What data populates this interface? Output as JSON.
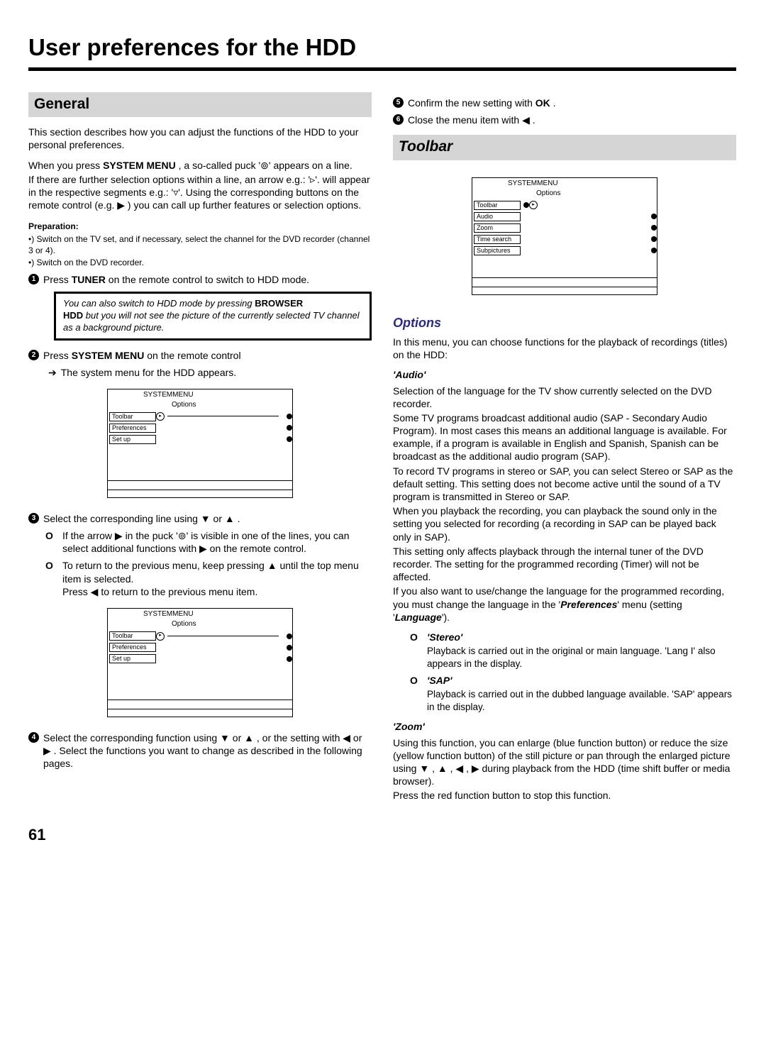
{
  "page": {
    "title": "User preferences for the HDD",
    "number": "61"
  },
  "left": {
    "section_heading": "General",
    "intro1": "This section describes how you can adjust the functions of the HDD to your personal preferences.",
    "intro2_pre": "When you press ",
    "intro2_btn": "SYSTEM MENU",
    "intro2_post": " , a so-called puck '⊚' appears on a line.",
    "intro3": "If there are further selection options within a line, an arrow e.g.: '▹'. will appear in the respective segments e.g.: '▿'. Using the corresponding buttons on the remote control (e.g. ▶ ) you can call up further features or selection options.",
    "prep_label": "Preparation:",
    "prep1": "•) Switch on the TV set, and if necessary, select the channel for the DVD recorder (channel 3 or 4).",
    "prep2": "•) Switch on the DVD recorder.",
    "step1_pre": "Press ",
    "step1_btn": "TUNER",
    "step1_post": " on the remote control to switch to HDD mode.",
    "callout_line1_pre": "You can also switch to HDD mode by pressing ",
    "callout_line1_b1": "BROWSER",
    "callout_line2_b": "HDD",
    "callout_line2_post": " but you will not see the picture of the currently selected TV channel as a background picture.",
    "step2_pre": "Press ",
    "step2_btn": "SYSTEM MENU",
    "step2_post": " on the remote control",
    "step2_result": "The system menu for the HDD appears.",
    "step3": "Select the corresponding line using ▼ or ▲ .",
    "step3_o1": "If the arrow ▶ in the puck '⊚' is visible in one of the lines, you can select additional functions with ▶ on the remote control.",
    "step3_o2a": "To return to the previous menu, keep pressing ▲ until the top menu item is selected.",
    "step3_o2b": "Press ◀ to return to the previous menu item.",
    "step4": "Select the corresponding function using ▼ or ▲ , or the setting with ◀ or ▶ . Select the functions you want to change as described in the following pages.",
    "menu": {
      "title": "SYSTEMMENU",
      "subtitle": "Options",
      "rows": [
        "Toolbar",
        "Preferences",
        "Set up"
      ]
    }
  },
  "right": {
    "step5_pre": "Confirm the new setting with ",
    "step5_btn": "OK",
    "step5_post": " .",
    "step6": "Close the menu item with ◀ .",
    "section_heading": "Toolbar",
    "menu": {
      "title": "SYSTEMMENU",
      "subtitle": "Options",
      "rows": [
        "Toolbar",
        "Audio",
        "Zoom",
        "Time search",
        "Subpictures"
      ]
    },
    "options_heading": "Options",
    "options_intro": "In this menu, you can choose functions for the playback of recordings (titles) on the HDD:",
    "audio_heading": "'Audio'",
    "audio_p1": "Selection of the language for the TV show currently selected on the DVD recorder.",
    "audio_p2": "Some TV programs broadcast additional audio (SAP - Secondary Audio Program). In most cases this means an additional language is available. For example, if a program is available in English and Spanish, Spanish can be broadcast as the additional audio program (SAP).",
    "audio_p3": "To record TV programs in stereo or SAP, you can select Stereo or SAP as the default setting. This setting does not become active until the sound of a TV program is transmitted in Stereo or SAP.",
    "audio_p4": "When you playback the recording, you can playback the sound only in the setting you selected for recording (a recording in SAP can be played back only in SAP).",
    "audio_p5": "This setting only affects playback through the internal tuner of the DVD recorder. The setting for the programmed recording (Timer) will not be affected.",
    "audio_p6_pre": "If you also want to use/change the language for the programmed recording, you must change the language in the '",
    "audio_p6_b1": "Preferences",
    "audio_p6_mid": "' menu (setting '",
    "audio_p6_b2": "Language",
    "audio_p6_post": "').",
    "opt_stereo_label": "'Stereo'",
    "opt_stereo_body": "Playback is carried out in the original or main language. 'Lang I' also appears in the display.",
    "opt_sap_label": "'SAP'",
    "opt_sap_body": "Playback is carried out in the dubbed language available. 'SAP' appears in the display.",
    "zoom_heading": "'Zoom'",
    "zoom_p1": "Using this function, you can enlarge (blue function button) or reduce the size (yellow function button) of the still picture or pan through the enlarged picture using ▼ , ▲ , ◀ , ▶ during playback from the HDD (time shift buffer or media browser).",
    "zoom_p2": "Press the red function button to stop this function."
  }
}
